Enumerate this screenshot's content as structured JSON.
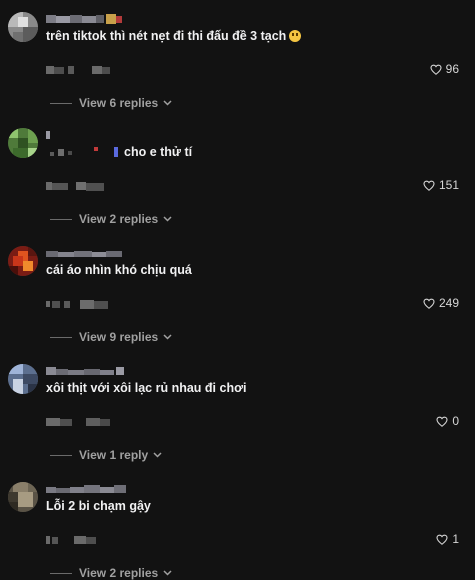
{
  "colors": {
    "background": "#121212",
    "text": "#f1f1f2",
    "muted": "#a0a0a0"
  },
  "comments": [
    {
      "text": "trên tiktok thì nét nẹt đi thi đấu đề 3 tạch",
      "emoji": "laughing-face",
      "likes": "96",
      "replies_label": "View 6 replies"
    },
    {
      "text": "cho e thử tí",
      "likes": "151",
      "replies_label": "View 2 replies"
    },
    {
      "text": "cái áo nhìn khó chịu quá",
      "likes": "249",
      "replies_label": "View 9 replies"
    },
    {
      "text": "xôi thịt với xôi lạc rủ nhau đi chơi",
      "likes": "0",
      "replies_label": "View 1 reply"
    },
    {
      "text": "Lỗi 2 bi chạm gậy",
      "likes": "1",
      "replies_label": "View 2 replies"
    }
  ]
}
